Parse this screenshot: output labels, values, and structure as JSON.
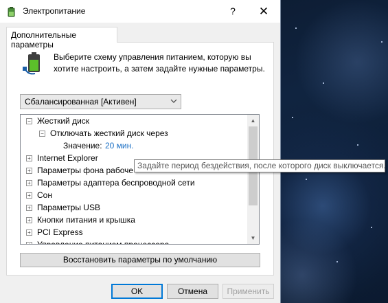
{
  "window": {
    "title": "Электропитание",
    "help_glyph": "?",
    "close_glyph": "✕",
    "icon": "power-options-icon"
  },
  "tab": {
    "label": "Дополнительные параметры"
  },
  "description": "Выберите схему управления питанием, которую вы хотите настроить, а затем задайте нужные параметры.",
  "plan_select": {
    "value": "Сбалансированная [Активен]"
  },
  "tree": {
    "items": [
      {
        "label": "Жесткий диск",
        "expander": "−"
      },
      {
        "label": "Отключать жесткий диск через",
        "expander": "−"
      },
      {
        "label": "Значение:",
        "value": "20 мин."
      },
      {
        "label": "Internet Explorer",
        "expander": "+"
      },
      {
        "label": "Параметры фона рабоче",
        "expander": "+"
      },
      {
        "label": "Параметры адаптера беспроводной сети",
        "expander": "+"
      },
      {
        "label": "Сон",
        "expander": "+"
      },
      {
        "label": "Параметры USB",
        "expander": "+"
      },
      {
        "label": "Кнопки питания и крышка",
        "expander": "+"
      },
      {
        "label": "PCI Express",
        "expander": "+"
      },
      {
        "label": "Управление питанием процессора",
        "expander": "+"
      }
    ]
  },
  "tooltip": "Задайте период бездействия, после которого диск выключается.",
  "buttons": {
    "restore": "Восстановить параметры по умолчанию",
    "ok": "OK",
    "cancel": "Отмена",
    "apply": "Применить"
  },
  "colors": {
    "accent": "#0078d7",
    "value_text": "#1a6fc4",
    "disabled_text": "#a0a0a0"
  }
}
